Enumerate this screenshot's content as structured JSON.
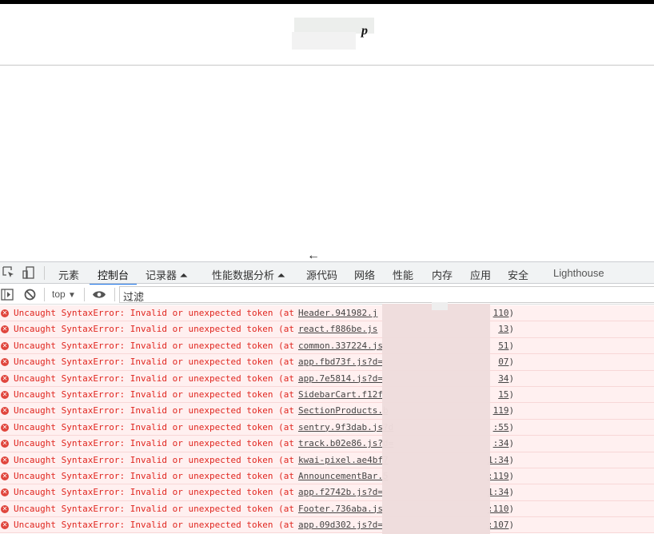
{
  "page": {
    "title_fragment": "p"
  },
  "devtools": {
    "tabs": [
      {
        "label": "元素"
      },
      {
        "label": "控制台",
        "active": true
      },
      {
        "label": "记录器 ⏶"
      },
      {
        "label": "性能数据分析 ⏶"
      },
      {
        "label": "源代码"
      },
      {
        "label": "网络"
      },
      {
        "label": "性能"
      },
      {
        "label": "内存"
      },
      {
        "label": "应用"
      },
      {
        "label": "安全"
      },
      {
        "label": "Lighthouse"
      }
    ],
    "toolbar": {
      "context": "top",
      "filter_placeholder": "过滤"
    },
    "messages": [
      {
        "text": "Uncaught SyntaxError: Invalid or unexpected token (at",
        "link": "Header.941982.j",
        "tail": "110"
      },
      {
        "text": "Uncaught SyntaxError: Invalid or unexpected token (at",
        "link": "react.f886be.js",
        "tail": "13"
      },
      {
        "text": "Uncaught SyntaxError: Invalid or unexpected token (at",
        "link": "common.337224.js",
        "tail": "51"
      },
      {
        "text": "Uncaught SyntaxError: Invalid or unexpected token (at",
        "link": "app.fbd73f.js?d=",
        "tail": "07"
      },
      {
        "text": "Uncaught SyntaxError: Invalid or unexpected token (at",
        "link": "app.7e5814.js?d=",
        "tail": "34"
      },
      {
        "text": "Uncaught SyntaxError: Invalid or unexpected token (at",
        "link": "SidebarCart.f12f",
        "tail": "15"
      },
      {
        "text": "Uncaught SyntaxError: Invalid or unexpected token (at",
        "link": "SectionProducts.b",
        "tail": "119"
      },
      {
        "text": "Uncaught SyntaxError: Invalid or unexpected token (at",
        "link": "sentry.9f3dab.js?d",
        "tail": ":55"
      },
      {
        "text": "Uncaught SyntaxError: Invalid or unexpected token (at",
        "link": "track.b02e86.js?d=",
        "tail": ":34"
      },
      {
        "text": "Uncaught SyntaxError: Invalid or unexpected token (at",
        "link": "kwai-pixel.ae4bf7",
        "tail": "1:34"
      },
      {
        "text": "Uncaught SyntaxError: Invalid or unexpected token (at",
        "link": "AnnouncementBar.5",
        "tail": ":119"
      },
      {
        "text": "Uncaught SyntaxError: Invalid or unexpected token (at",
        "link": "app.f2742b.js?d=",
        "tail": "1:34"
      },
      {
        "text": "Uncaught SyntaxError: Invalid or unexpected token (at",
        "link": "Footer.736aba.js",
        "tail": ":110"
      },
      {
        "text": "Uncaught SyntaxError: Invalid or unexpected token (at",
        "link": "app.09d302.js?d=",
        "tail": ":107"
      }
    ]
  }
}
